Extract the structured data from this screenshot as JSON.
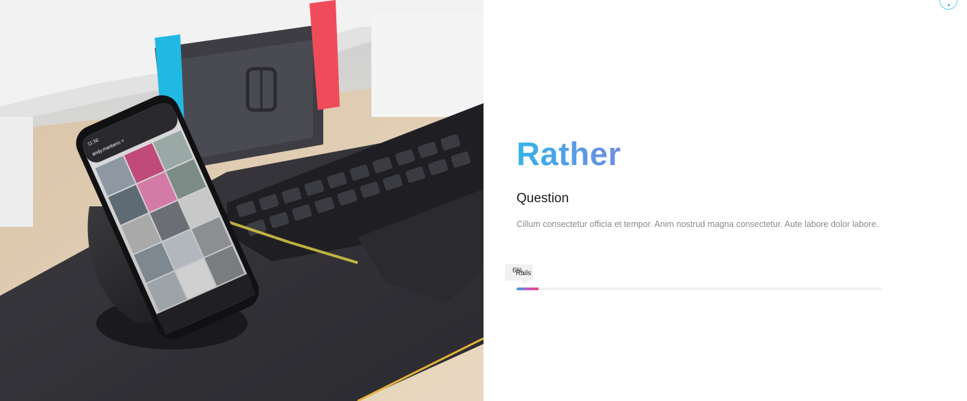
{
  "hero": {
    "title": "Rather",
    "subtitle": "Question",
    "description": "Cillum consectetur officia et tempor. Anim nostrud magna consectetur. Aute labore dolor labore."
  },
  "skill": {
    "label": "Rails",
    "percent_text": "6%",
    "fill_fraction": 0.06
  },
  "photo": {
    "phone_status": "11:56",
    "phone_username": "andy.mantarro ˅"
  },
  "colors": {
    "title_gradient_start": "#34b3e9",
    "title_gradient_end": "#6f8de3",
    "progress_start": "#2fa8e8",
    "progress_end": "#ef4a7a",
    "accent": "#1fb6e6"
  },
  "icons": {
    "corner": "dot-circle-icon"
  }
}
